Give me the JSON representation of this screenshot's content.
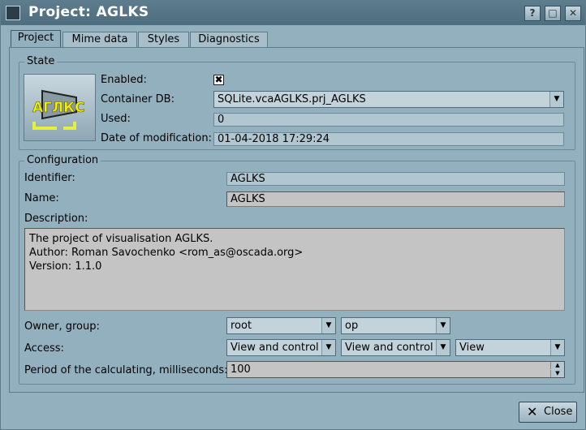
{
  "window": {
    "title": "Project: AGLKS",
    "help_btn": "?",
    "max_btn": "□",
    "close_btn": "✕"
  },
  "tabs": [
    "Project",
    "Mime data",
    "Styles",
    "Diagnostics"
  ],
  "state": {
    "group_title": "State",
    "logo_text": "АГЛКС",
    "enabled_label": "Enabled:",
    "enabled_checked": "✖",
    "container_label": "Container DB:",
    "container_value": "SQLite.vcaAGLKS.prj_AGLKS",
    "used_label": "Used:",
    "used_value": "0",
    "modified_label": "Date of modification:",
    "modified_value": "01-04-2018 17:29:24"
  },
  "config": {
    "group_title": "Configuration",
    "identifier_label": "Identifier:",
    "identifier_value": "AGLKS",
    "name_label": "Name:",
    "name_value": "AGLKS",
    "description_label": "Description:",
    "description_lines": [
      "The project of visualisation AGLKS.",
      "Author: Roman Savochenko <rom_as@oscada.org>",
      "Version: 1.1.0"
    ],
    "owner_label": "Owner, group:",
    "owner_value": "root",
    "group_value": "op",
    "access_label": "Access:",
    "access_owner": "View and control",
    "access_group": "View and control",
    "access_other": "View",
    "period_label": "Period of the calculating, milliseconds:",
    "period_value": "100"
  },
  "footer": {
    "close_label": "Close"
  }
}
